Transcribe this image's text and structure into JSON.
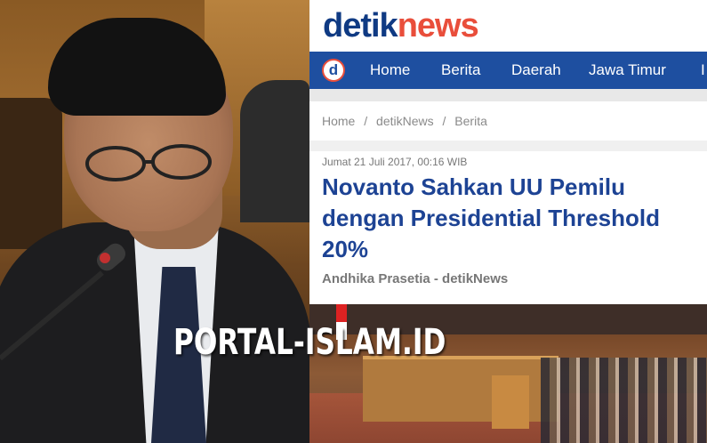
{
  "site": {
    "logo_part1": "detik",
    "logo_part2": "news",
    "nav_logo_letter": "d",
    "nav": [
      "Home",
      "Berita",
      "Daerah",
      "Jawa Timur",
      "I"
    ]
  },
  "breadcrumb": [
    "Home",
    "/",
    "detikNews",
    "/",
    "Berita"
  ],
  "article": {
    "date": "Jumat 21 Juli 2017, 00:16 WIB",
    "headline": "Novanto Sahkan UU Pemilu dengan Presidential Threshold 20%",
    "author": "Andhika Prasetia - detikNews"
  },
  "watermark": "PORTAL-ISLAM.ID",
  "colors": {
    "brand_blue": "#1e4fa0",
    "logo_blue": "#0f3a83",
    "logo_red": "#e94e3b",
    "headline": "#1d4394"
  }
}
